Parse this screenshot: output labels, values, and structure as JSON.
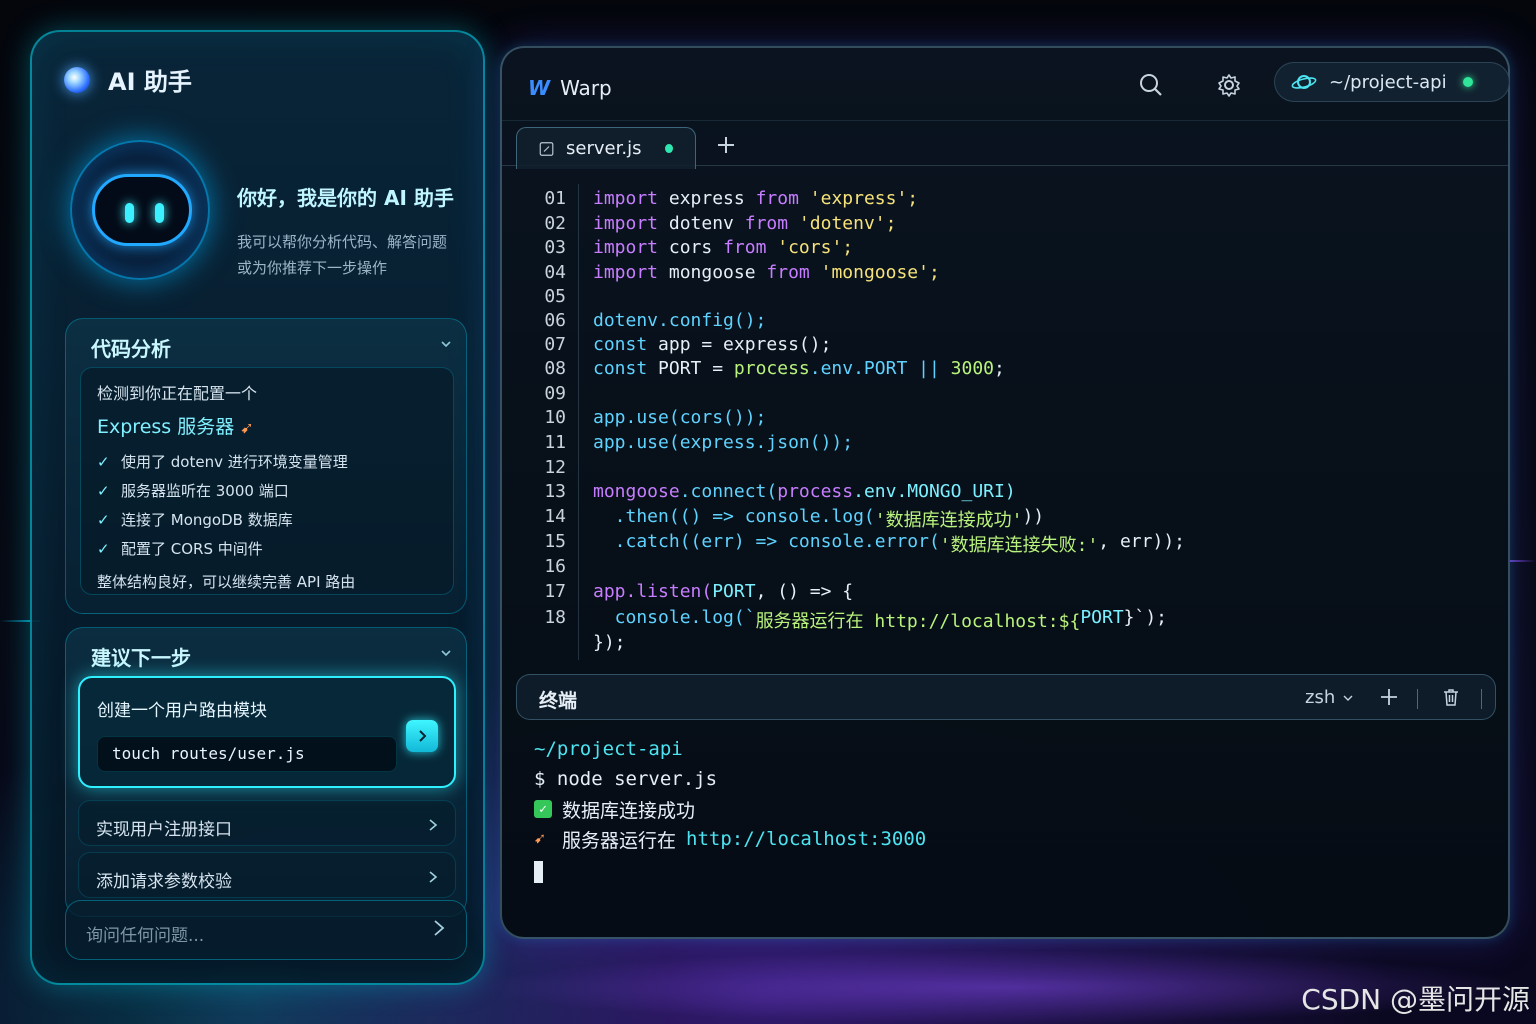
{
  "assistant": {
    "title": "AI 助手",
    "greeting_title": "你好，我是你的 AI 助手",
    "greeting_line1": "我可以帮你分析代码、解答问题",
    "greeting_line2": "或为你推荐下一步操作",
    "analysis": {
      "heading": "代码分析",
      "line1": "检测到你正在配置一个",
      "line2": "Express 服务器",
      "checks": [
        "使用了 dotenv 进行环境变量管理",
        "服务器监听在 3000 端口",
        "连接了 MongoDB 数据库",
        "配置了 CORS 中间件"
      ],
      "summary": "整体结构良好，可以继续完善 API 路由"
    },
    "next_steps": {
      "heading": "建议下一步",
      "active_label": "创建一个用户路由模块",
      "active_command": "touch routes/user.js",
      "item2": "实现用户注册接口",
      "item3": "添加请求参数校验"
    },
    "ask_placeholder": "询问任何问题..."
  },
  "warp": {
    "app_name": "Warp",
    "project": "~/project-api",
    "tab_name": "server.js",
    "terminal": {
      "title": "终端",
      "shell": "zsh",
      "path": "~/project-api",
      "command": "$ node server.js",
      "out1": "数据库连接成功",
      "out2_text": "服务器运行在",
      "out2_url": "http://localhost:3000"
    }
  },
  "code_lines": [
    "01",
    "02",
    "03",
    "04",
    "05",
    "06",
    "07",
    "08",
    "09",
    "10",
    "11",
    "12",
    "13",
    "14",
    "15",
    "16",
    "17",
    "18"
  ],
  "code": {
    "l01": [
      "import",
      " express ",
      "from",
      " 'express';"
    ],
    "l02": [
      "import",
      " dotenv ",
      "from",
      " 'dotenv';"
    ],
    "l03": [
      "import",
      " cors ",
      "from",
      " 'cors';"
    ],
    "l04": [
      "import",
      " mongoose ",
      "from",
      " 'mongoose';"
    ],
    "l06": "dotenv.config();",
    "l07a": "const",
    "l07b": " app = express();",
    "l08a": "const",
    "l08b": " PORT = ",
    "l08c": "process",
    "l08d": ".env.PORT || ",
    "l08e": "3000",
    "l08f": ";",
    "l10": "app.use(cors());",
    "l11": "app.use(express.json());",
    "l13a": "mongoose",
    "l13b": ".connect(",
    "l13c": "process",
    "l13d": ".env.MONGO_URI)",
    "l14a": "  .then(() => console.log(",
    "l14b": "'数据库连接成功'",
    "l14c": "))",
    "l15a": "  .catch((err) => console.error(",
    "l15b": "'数据库连接失败:'",
    "l15c": ", err));",
    "l17a": "app.listen(",
    "l17b": "PORT",
    "l17c": ", () => {",
    "l18a": "  console.log(`",
    "l18b": "服务器运行在 http://localhost:${",
    "l18c": "PORT",
    "l18d": "}`);",
    "l19": "});"
  },
  "watermark": "CSDN @墨问开源",
  "colors": {
    "accent": "#2ef0ff",
    "keyword": "#c77dff",
    "string": "#f6e27a",
    "status_green": "#2fe69a"
  }
}
